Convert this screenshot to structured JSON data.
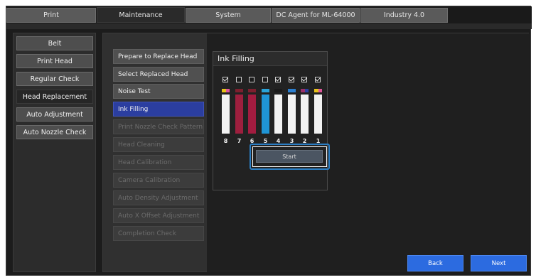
{
  "tabs": [
    {
      "label": "Print"
    },
    {
      "label": "Maintenance"
    },
    {
      "label": "System"
    },
    {
      "label": "DC Agent for ML-64000"
    },
    {
      "label": "Industry 4.0"
    }
  ],
  "sidebar": {
    "items": [
      {
        "label": "Belt"
      },
      {
        "label": "Print Head"
      },
      {
        "label": "Regular Check"
      },
      {
        "label": "Head Replacement"
      },
      {
        "label": "Auto Adjustment"
      },
      {
        "label": "Auto Nozzle Check"
      }
    ]
  },
  "steps": {
    "items": [
      {
        "label": "Prepare to Replace Head"
      },
      {
        "label": "Select Replaced Head"
      },
      {
        "label": "Noise Test"
      },
      {
        "label": "Ink Filling"
      },
      {
        "label": "Print Nozzle Check Pattern"
      },
      {
        "label": "Head Cleaning"
      },
      {
        "label": "Head Calibration"
      },
      {
        "label": "Camera Calibration"
      },
      {
        "label": "Auto Density Adjustment"
      },
      {
        "label": "Auto X Offset Adjustment"
      },
      {
        "label": "Completion Check"
      }
    ]
  },
  "ink_filling": {
    "title": "Ink Filling",
    "channels": [
      {
        "number": "8",
        "checked": true,
        "colors": [
          "#e6c21a",
          "#e0559a"
        ],
        "fill_color": "",
        "fill_level": 0
      },
      {
        "number": "7",
        "checked": false,
        "colors": [
          "#7d1f2e"
        ],
        "fill_color": "#9e1f3e",
        "fill_level": 1.0
      },
      {
        "number": "6",
        "checked": false,
        "colors": [
          "#7d1f2e"
        ],
        "fill_color": "#a31c40",
        "fill_level": 1.0
      },
      {
        "number": "5",
        "checked": false,
        "colors": [
          "#2aa3d8"
        ],
        "fill_color": "#1f95d6",
        "fill_level": 1.0
      },
      {
        "number": "4",
        "checked": true,
        "colors": [
          "#1a1a1a"
        ],
        "fill_color": "",
        "fill_level": 0
      },
      {
        "number": "3",
        "checked": true,
        "colors": [
          "#2b7fd0"
        ],
        "fill_color": "",
        "fill_level": 0
      },
      {
        "number": "2",
        "checked": true,
        "colors": [
          "#9a2f6a",
          "#2b3ea0"
        ],
        "fill_color": "",
        "fill_level": 0
      },
      {
        "number": "1",
        "checked": true,
        "colors": [
          "#e6c21a",
          "#e0559a"
        ],
        "fill_color": "",
        "fill_level": 0
      }
    ],
    "start_label": "Start"
  },
  "footer": {
    "back_label": "Back",
    "next_label": "Next"
  },
  "colors": {
    "accent_blue": "#2c6be0",
    "active_step": "#2b3ea0",
    "highlight_frame": "#2b7ec4"
  }
}
